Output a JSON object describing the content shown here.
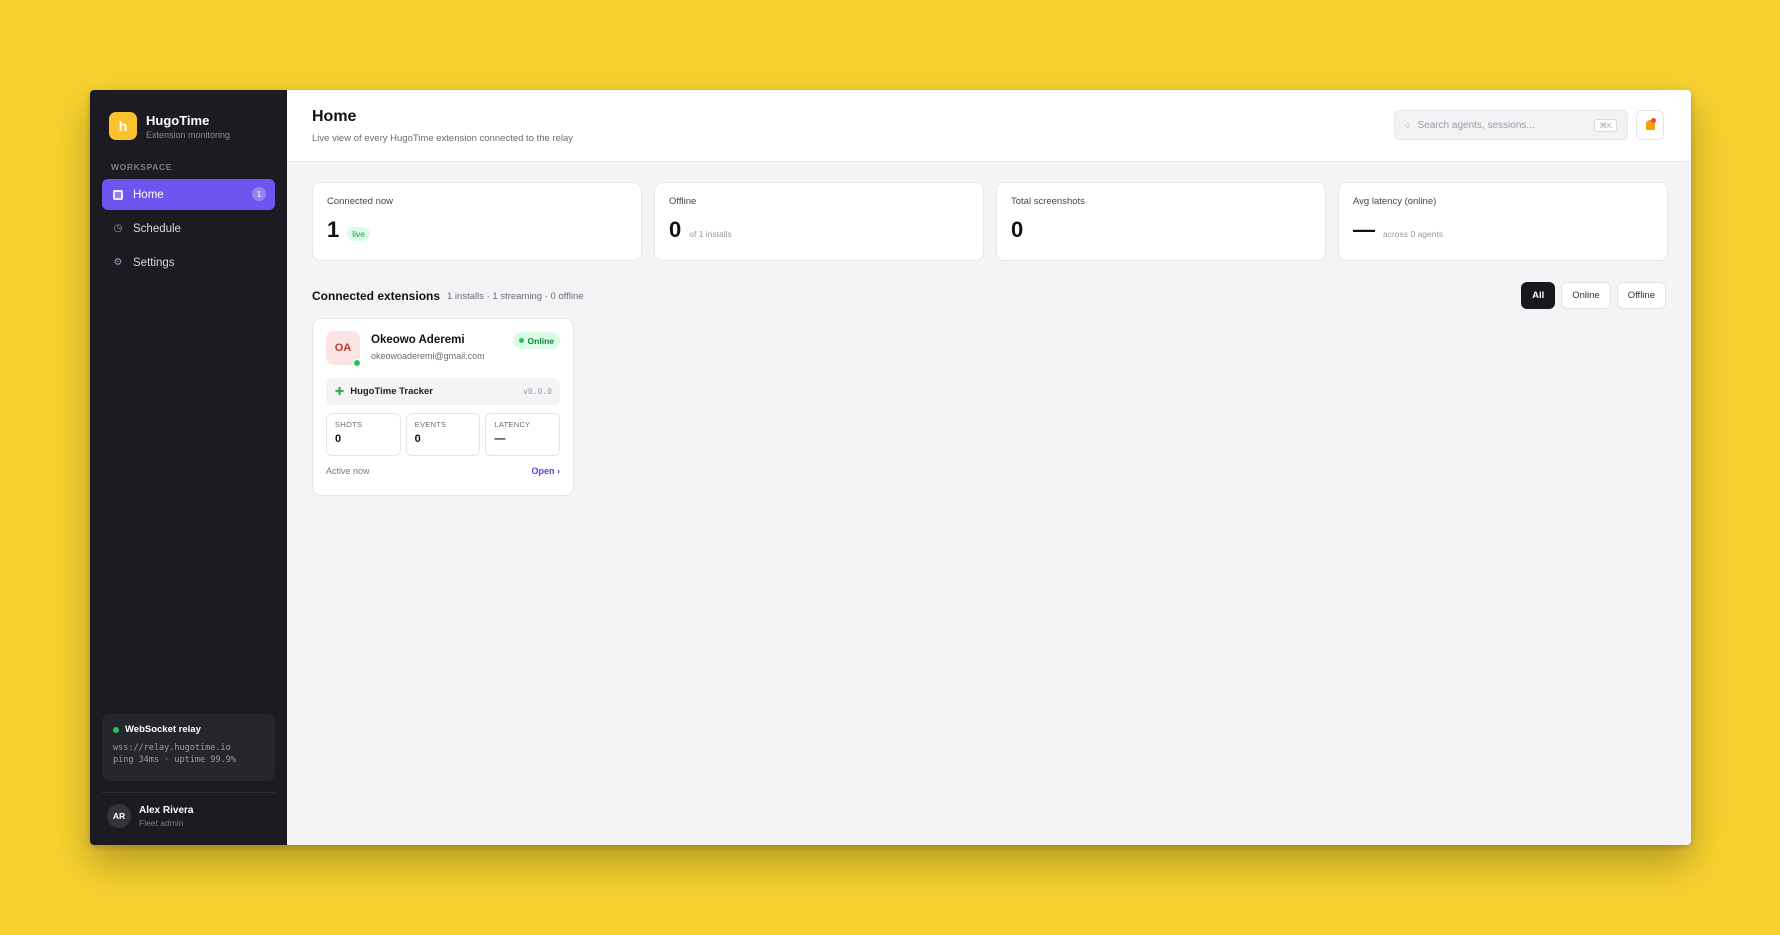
{
  "brand": {
    "logo_letter": "h",
    "name": "HugoTime",
    "subtitle": "Extension monitoring",
    "color": "#F9C22E"
  },
  "sidebar": {
    "section_label": "WORKSPACE",
    "items": [
      {
        "label": "Home",
        "icon": "grid-icon",
        "active": true,
        "badge": "1"
      },
      {
        "label": "Schedule",
        "icon": "clock-icon",
        "active": false
      },
      {
        "label": "Settings",
        "icon": "gear-icon",
        "active": false
      }
    ],
    "relay": {
      "title": "WebSocket relay",
      "url": "wss://relay.hugotime.io",
      "stats": "ping 34ms · uptime 99.9%"
    },
    "user": {
      "initials": "AR",
      "name": "Alex Rivera",
      "role": "Fleet admin"
    }
  },
  "header": {
    "title": "Home",
    "subtitle": "Live view of every HugoTime extension connected to the relay",
    "search": {
      "placeholder": "Search agents, sessions...",
      "shortcut": "⌘K"
    },
    "bell_icon": "bell-icon"
  },
  "stats": [
    {
      "label": "Connected now",
      "value": "1",
      "pill": "live"
    },
    {
      "label": "Offline",
      "value": "0",
      "note": "of 1 installs"
    },
    {
      "label": "Total screenshots",
      "value": "0"
    },
    {
      "label": "Avg latency (online)",
      "value": "—",
      "note": "across 0 agents"
    }
  ],
  "list": {
    "title": "Connected extensions",
    "meta": "1 installs · 1 streaming · 0 offline",
    "filters": [
      {
        "label": "All",
        "active": true
      },
      {
        "label": "Online",
        "active": false
      },
      {
        "label": "Offline",
        "active": false
      }
    ]
  },
  "cards": [
    {
      "initials": "OA",
      "name": "Okeowo Aderemi",
      "email": "okeowoaderemi@gmail.com",
      "status": "Online",
      "extension": {
        "icon": "puzzle-icon",
        "name": "HugoTime Tracker",
        "version": "v0.0.0"
      },
      "metrics": [
        {
          "label": "SHOTS",
          "value": "0"
        },
        {
          "label": "EVENTS",
          "value": "0"
        },
        {
          "label": "LATENCY",
          "value": "—"
        }
      ],
      "activity": "Active now",
      "open_label": "Open ›"
    }
  ],
  "colors": {
    "accent": "#6E55F0",
    "background": "#F7D22F",
    "sidebar": "#1B1B21",
    "online": "#22C55E"
  }
}
